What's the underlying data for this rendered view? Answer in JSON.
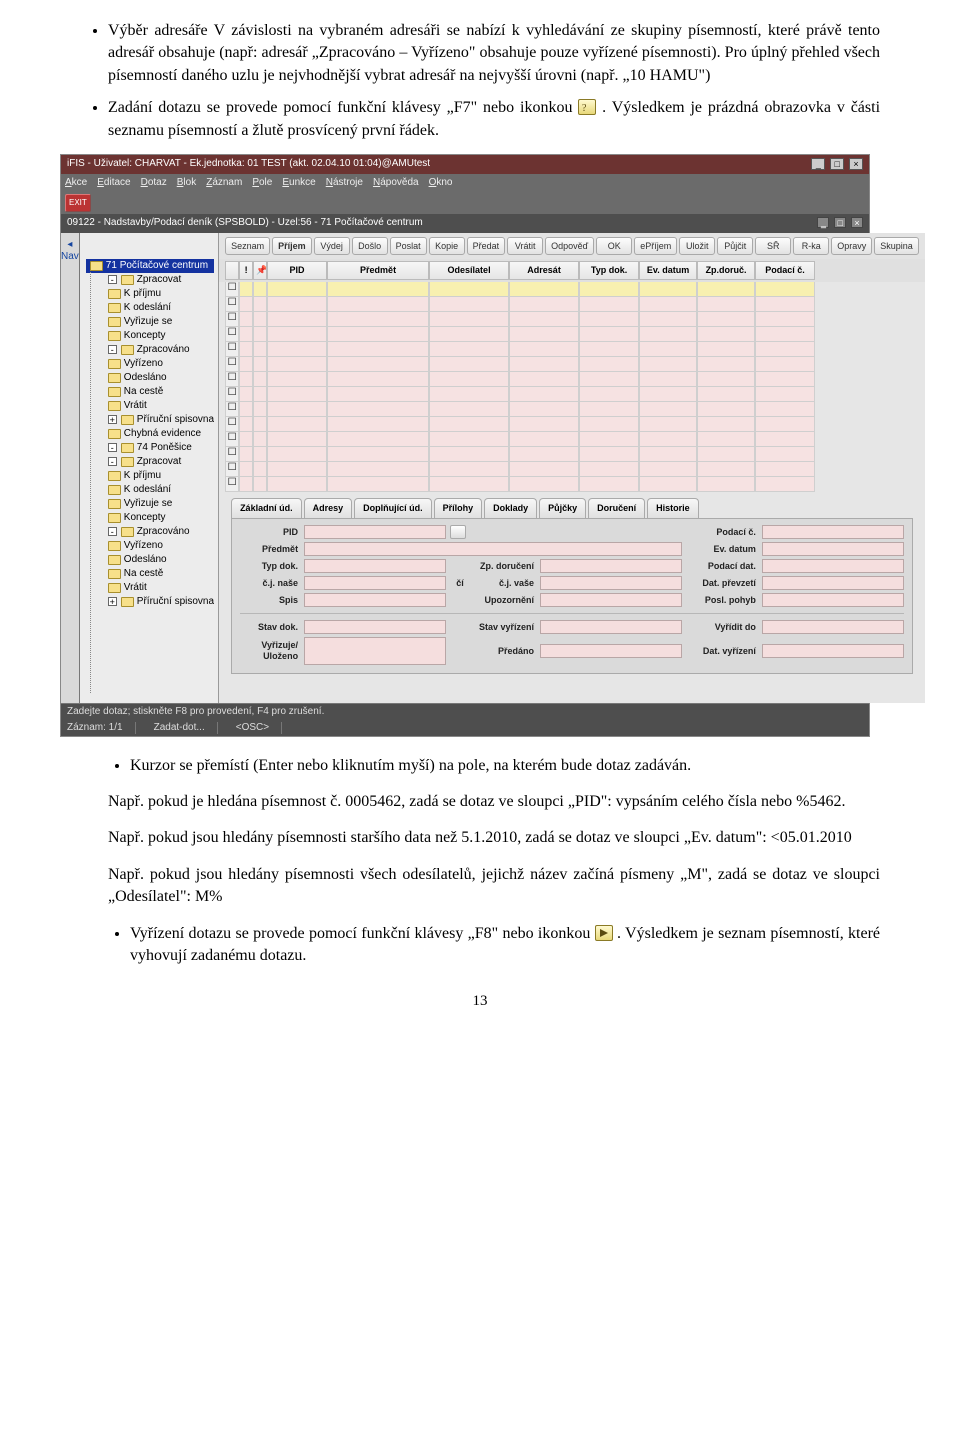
{
  "doc": {
    "bullets_top": [
      "Výběr adresáře\nV závislosti na vybraném adresáři se nabízí k vyhledávání ze skupiny písemností, které právě tento adresář obsahuje (např: adresář „Zpracováno – Vyřízeno\" obsahuje pouze vyřízené písemnosti). Pro úplný přehled všech písemností daného uzlu je nejvhodnější vybrat adresář na nejvyšší úrovni (např. „10 HAMU\")",
      "Zadání dotazu se provede pomocí funkční klávesy „F7\" nebo ikonkou . Výsledkem je prázdná obrazovka v části seznamu písemností a žlutě prosvícený první řádek."
    ],
    "bullets_bottom": [
      "Kurzor se přemístí (Enter nebo kliknutím myší) na pole, na kterém bude dotaz zadáván.",
      "Např. pokud je hledána písemnost č. 0005462, zadá se dotaz ve sloupci „PID\": vypsáním celého čísla nebo %5462.",
      "Např. pokud jsou hledány písemnosti staršího data než 5.1.2010, zadá se dotaz ve sloupci „Ev. datum\": <05.01.2010",
      "Např. pokud jsou hledány písemnosti všech odesílatelů, jejichž název začíná písmeny „M\", zadá se dotaz ve sloupci „Odesílatel\": M%",
      "Vyřízení dotazu se provede pomocí funkční klávesy „F8\" nebo ikonkou . Výsledkem je seznam písemností, které vyhovují zadanému dotazu."
    ],
    "page": "13"
  },
  "app": {
    "title": "iFIS - Uživatel: CHARVAT - Ek.jednotka: 01 TEST (akt. 02.04.10 01:04)@AMUtest",
    "menu": [
      "Akce",
      "Editace",
      "Dotaz",
      "Blok",
      "Záznam",
      "Pole",
      "Eunkce",
      "Nástroje",
      "Nápověda",
      "Okno"
    ],
    "icon_exit": "EXIT",
    "subtitle": "09122 - Nadstavby/Podací deník (SPSBOLD) - Uzel:56 - 71 Počítačové centrum",
    "nav_label": "Nav",
    "tree": [
      {
        "t": "71 Počítačové centrum",
        "cls": "root"
      },
      {
        "t": "Zpracovat",
        "cls": "sub",
        "pm": "-"
      },
      {
        "t": "K příjmu",
        "cls": "sub2"
      },
      {
        "t": "K odeslání",
        "cls": "sub2"
      },
      {
        "t": "Vyřizuje se",
        "cls": "sub2"
      },
      {
        "t": "Koncepty",
        "cls": "sub2"
      },
      {
        "t": "Zpracováno",
        "cls": "sub",
        "pm": "-"
      },
      {
        "t": "Vyřízeno",
        "cls": "sub2"
      },
      {
        "t": "Odesláno",
        "cls": "sub2"
      },
      {
        "t": "Na cestě",
        "cls": "sub"
      },
      {
        "t": "Vrátit",
        "cls": "sub"
      },
      {
        "t": "Příruční spisovna",
        "cls": "sub",
        "pm": "+"
      },
      {
        "t": "Chybná evidence",
        "cls": "sub"
      },
      {
        "t": "74 Poněšice",
        "cls": "sub",
        "pm": "-"
      },
      {
        "t": "Zpracovat",
        "cls": "sub",
        "pm": "-"
      },
      {
        "t": "K příjmu",
        "cls": "sub2"
      },
      {
        "t": "K odeslání",
        "cls": "sub2"
      },
      {
        "t": "Vyřizuje se",
        "cls": "sub2"
      },
      {
        "t": "Koncepty",
        "cls": "sub2"
      },
      {
        "t": "Zpracováno",
        "cls": "sub",
        "pm": "-"
      },
      {
        "t": "Vyřízeno",
        "cls": "sub2"
      },
      {
        "t": "Odesláno",
        "cls": "sub2"
      },
      {
        "t": "Na cestě",
        "cls": "sub"
      },
      {
        "t": "Vrátit",
        "cls": "sub"
      },
      {
        "t": "Příruční spisovna",
        "cls": "sub",
        "pm": "+"
      }
    ],
    "segments": [
      "Seznam",
      "Příjem",
      "Výdej",
      "Došlo",
      "Poslat",
      "Kopie",
      "Předat",
      "Vrátit",
      "Odpověď",
      "OK",
      "ePříjem",
      "Uložit",
      "Půjčit",
      "SŘ",
      "R-ka",
      "Opravy",
      "Skupina"
    ],
    "grid_headers": [
      "!",
      "📌",
      "PID",
      "Předmět",
      "Odesílatel",
      "Adresát",
      "Typ dok.",
      "Ev. datum",
      "Zp.doruč.",
      "Podací č."
    ],
    "detail_tabs": [
      "Základní úd.",
      "Adresy",
      "Doplňující úd.",
      "Přílohy",
      "Doklady",
      "Půjčky",
      "Doručení",
      "Historie"
    ],
    "form": {
      "pid": "PID",
      "podaci_c": "Podací č.",
      "predmet": "Předmět",
      "ev_datum": "Ev. datum",
      "typ": "Typ dok.",
      "zp": "Zp. doručení",
      "podaci_dat": "Podací dat.",
      "cj_nase": "č.j. naše",
      "cj_ci": "čí",
      "cj_vase": "č.j. vaše",
      "dat_prev": "Dat. převzetí",
      "spis": "Spis",
      "upozorneni": "Upozornění",
      "posl_pohyb": "Posl. pohyb",
      "stav_dok": "Stav dok.",
      "stav_vyr": "Stav vyřízení",
      "vyridit_do": "Vyřídit do",
      "vyrizuje": "Vyřizuje/\nUloženo",
      "predano": "Předáno",
      "dat_vyr": "Dat. vyřízení"
    },
    "status_tip": "Zadejte dotaz; stiskněte F8 pro provedení, F4 pro zrušení.",
    "status": {
      "rec": "Záznam: 1/1",
      "mode": "Zadat-dot...",
      "osc": "<OSC>"
    }
  }
}
